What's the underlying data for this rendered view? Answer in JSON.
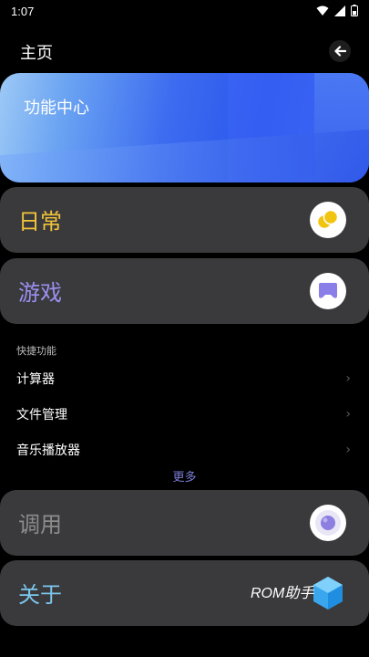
{
  "status_bar": {
    "time": "1:07"
  },
  "header": {
    "title": "主页"
  },
  "banner": {
    "label": "功能中心"
  },
  "cards": [
    {
      "label": "日常",
      "color": "#f2c43a",
      "icon": "coins-icon"
    },
    {
      "label": "游戏",
      "color": "#9b8ff0",
      "icon": "gamepad-icon"
    },
    {
      "label": "调用",
      "color": "#8c8c8c",
      "icon": "orb-icon"
    },
    {
      "label": "关于",
      "color": "#7cc7ee",
      "icon": "cube-icon"
    }
  ],
  "quick": {
    "title": "快捷功能",
    "items": [
      {
        "label": "计算器"
      },
      {
        "label": "文件管理"
      },
      {
        "label": "音乐播放器"
      }
    ],
    "more_label": "更多"
  },
  "watermark": "ROM助手"
}
